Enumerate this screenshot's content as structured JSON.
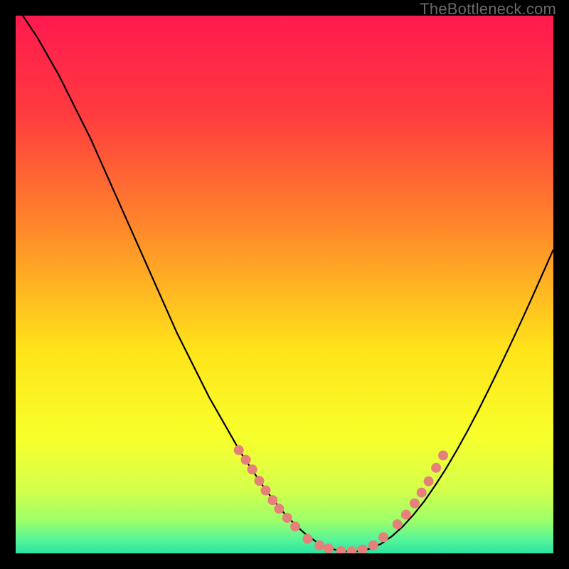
{
  "watermark": "TheBottleneck.com",
  "chart_data": {
    "type": "line",
    "title": "",
    "xlabel": "",
    "ylabel": "",
    "xlim": [
      0,
      100
    ],
    "ylim": [
      0,
      100
    ],
    "background_gradient_stops": [
      {
        "offset": 0.0,
        "color": "#ff1a4f"
      },
      {
        "offset": 0.18,
        "color": "#ff3a3f"
      },
      {
        "offset": 0.4,
        "color": "#ff8a2a"
      },
      {
        "offset": 0.62,
        "color": "#ffe31a"
      },
      {
        "offset": 0.78,
        "color": "#f8ff2a"
      },
      {
        "offset": 0.88,
        "color": "#d6ff4a"
      },
      {
        "offset": 0.94,
        "color": "#9cff6a"
      },
      {
        "offset": 0.975,
        "color": "#55f59a"
      },
      {
        "offset": 1.0,
        "color": "#2de2a0"
      }
    ],
    "series": [
      {
        "name": "bottleneck-curve",
        "x": [
          0,
          2,
          4,
          6,
          8,
          10,
          12,
          14,
          16,
          18,
          20,
          22,
          24,
          26,
          28,
          30,
          32,
          34,
          36,
          38,
          40,
          42,
          44,
          46,
          48,
          50,
          52,
          54,
          56,
          58,
          60,
          62,
          64,
          66,
          68,
          70,
          72,
          74,
          76,
          78,
          80,
          82,
          84,
          86,
          88,
          90,
          92,
          94,
          96,
          98,
          100
        ],
        "y": [
          102,
          99,
          96,
          92.5,
          89,
          85,
          81,
          77,
          72.5,
          68,
          63.5,
          59,
          54.5,
          50,
          45.5,
          41,
          37,
          33,
          29,
          25.5,
          22,
          18.5,
          15.5,
          12.5,
          9.8,
          7.4,
          5.3,
          3.5,
          2.1,
          1.1,
          0.5,
          0.3,
          0.4,
          0.9,
          1.8,
          3.2,
          5.0,
          7.2,
          9.7,
          12.6,
          15.7,
          19.1,
          22.7,
          26.5,
          30.5,
          34.6,
          38.8,
          43.1,
          47.5,
          52.0,
          56.5
        ]
      }
    ],
    "markers": {
      "name": "salmon-dots",
      "color": "#e6807b",
      "radius_px": 7,
      "points": [
        {
          "x": 41.5,
          "y": 19.2
        },
        {
          "x": 42.8,
          "y": 17.4
        },
        {
          "x": 44.0,
          "y": 15.6
        },
        {
          "x": 45.3,
          "y": 13.5
        },
        {
          "x": 46.5,
          "y": 11.7
        },
        {
          "x": 47.8,
          "y": 9.9
        },
        {
          "x": 49.0,
          "y": 8.3
        },
        {
          "x": 50.5,
          "y": 6.6
        },
        {
          "x": 52.0,
          "y": 5.0
        },
        {
          "x": 54.3,
          "y": 2.7
        },
        {
          "x": 56.5,
          "y": 1.5
        },
        {
          "x": 58.2,
          "y": 0.9
        },
        {
          "x": 60.5,
          "y": 0.4
        },
        {
          "x": 62.5,
          "y": 0.4
        },
        {
          "x": 64.5,
          "y": 0.7
        },
        {
          "x": 66.5,
          "y": 1.5
        },
        {
          "x": 68.4,
          "y": 3.0
        },
        {
          "x": 71.0,
          "y": 5.4
        },
        {
          "x": 72.6,
          "y": 7.2
        },
        {
          "x": 74.2,
          "y": 9.3
        },
        {
          "x": 75.5,
          "y": 11.3
        },
        {
          "x": 76.8,
          "y": 13.4
        },
        {
          "x": 78.2,
          "y": 15.9
        },
        {
          "x": 79.5,
          "y": 18.2
        }
      ]
    }
  }
}
